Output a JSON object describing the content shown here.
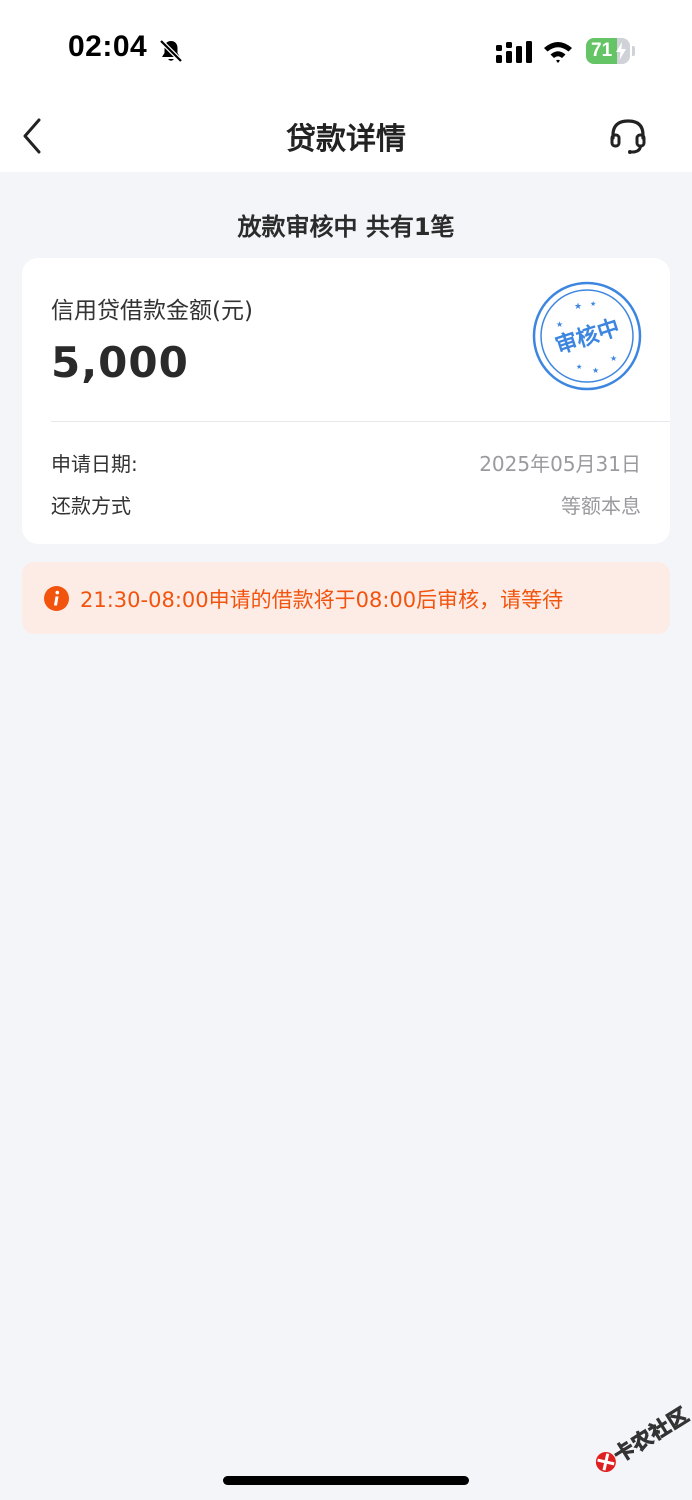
{
  "status_bar": {
    "time": "02:04",
    "battery_percent": "71",
    "battery_level": 0.71,
    "icons": [
      "bell-slash-icon",
      "cellular-signal-icon",
      "wifi-icon",
      "battery-icon"
    ]
  },
  "nav": {
    "title": "贷款详情",
    "back_icon": "chevron-left-icon",
    "service_icon": "headset-icon"
  },
  "section": {
    "heading": "放款审核中 共有1笔"
  },
  "loan_card": {
    "amount_label": "信用贷借款金额(元)",
    "amount_value": "5,000",
    "stamp_text": "审核中",
    "rows": [
      {
        "label": "申请日期:",
        "value": "2025年05月31日"
      },
      {
        "label": "还款方式",
        "value": "等额本息"
      }
    ]
  },
  "notice": {
    "icon": "info-icon",
    "text": "21:30-08:00申请的借款将于08:00后审核，请等待"
  },
  "watermark": {
    "text": "卡农社区"
  },
  "colors": {
    "page_bg": "#f4f5f9",
    "card_bg": "#ffffff",
    "stamp_blue": "#3d86e0",
    "notice_bg": "#fdece6",
    "notice_text": "#f2540e",
    "battery_green": "#65c466"
  }
}
